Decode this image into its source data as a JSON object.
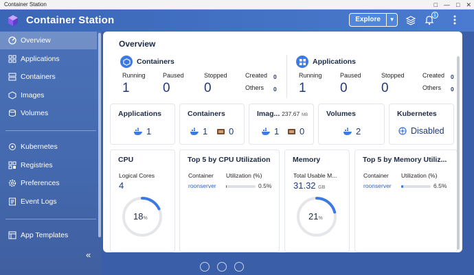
{
  "os": {
    "window_title": "Container Station",
    "controls": [
      "□",
      "—",
      "□",
      "✕"
    ]
  },
  "header": {
    "title": "Container Station",
    "explore_label": "Explore",
    "notification_count": "1"
  },
  "sidebar": {
    "items": [
      {
        "label": "Overview",
        "icon": "overview-icon"
      },
      {
        "label": "Applications",
        "icon": "applications-icon"
      },
      {
        "label": "Containers",
        "icon": "containers-icon"
      },
      {
        "label": "Images",
        "icon": "images-icon"
      },
      {
        "label": "Volumes",
        "icon": "volumes-icon"
      },
      {
        "label": "Kubernetes",
        "icon": "kubernetes-icon"
      },
      {
        "label": "Registries",
        "icon": "registries-icon"
      },
      {
        "label": "Preferences",
        "icon": "preferences-icon"
      },
      {
        "label": "Event Logs",
        "icon": "event-logs-icon"
      },
      {
        "label": "App Templates",
        "icon": "app-templates-icon"
      }
    ],
    "collapse_glyph": "«"
  },
  "overview": {
    "title": "Overview",
    "containers": {
      "title": "Containers",
      "running_label": "Running",
      "running": "1",
      "paused_label": "Paused",
      "paused": "0",
      "stopped_label": "Stopped",
      "stopped": "0",
      "created_label": "Created",
      "created": "0",
      "others_label": "Others",
      "others": "0"
    },
    "applications": {
      "title": "Applications",
      "running_label": "Running",
      "running": "1",
      "paused_label": "Paused",
      "paused": "0",
      "stopped_label": "Stopped",
      "stopped": "0",
      "created_label": "Created",
      "created": "0",
      "others_label": "Others",
      "others": "0"
    },
    "cards": {
      "applications": {
        "title": "Applications",
        "count": "1"
      },
      "containers": {
        "title": "Containers",
        "running": "1",
        "stopped": "0"
      },
      "images": {
        "title": "Imag...",
        "size": "237.67",
        "unit": "MB",
        "count1": "1",
        "count2": "0"
      },
      "volumes": {
        "title": "Volumes",
        "count": "2"
      },
      "kubernetes": {
        "title": "Kubernetes",
        "status": "Disabled"
      }
    },
    "cpu": {
      "title": "CPU",
      "cores_label": "Logical Cores",
      "cores": "4",
      "usage": "18",
      "usage_unit": "%",
      "usage_fraction": 0.18
    },
    "top_cpu": {
      "title": "Top 5 by CPU Utilization",
      "col_container": "Container",
      "col_util": "Utilization (%)",
      "rows": [
        {
          "name": "roonserver",
          "value": "0.5%",
          "fraction": 0.005
        }
      ]
    },
    "memory": {
      "title": "Memory",
      "total_label": "Total Usable M...",
      "total": "31.32",
      "unit": "GB",
      "usage": "21",
      "usage_unit": "%",
      "usage_fraction": 0.21
    },
    "top_mem": {
      "title": "Top 5 by Memory Utiliz...",
      "col_container": "Container",
      "col_util": "Utilization (%)",
      "rows": [
        {
          "name": "roonserver",
          "value": "6.5%",
          "fraction": 0.065
        }
      ]
    }
  },
  "colors": {
    "accent": "#3d7ae0",
    "header": "#3b66b6",
    "sidebar": "#4a71b8"
  }
}
